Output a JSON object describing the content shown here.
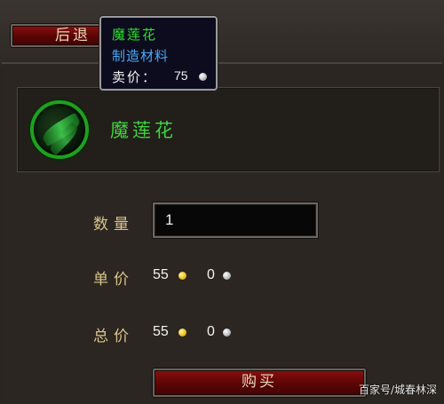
{
  "header": {
    "back_label": "后退"
  },
  "tooltip": {
    "item_name": "魔莲花",
    "item_type": "制造材料",
    "sell_label": "卖价：",
    "sell_price": "75",
    "sell_coin": "silver-coin-icon"
  },
  "item": {
    "name": "魔莲花",
    "icon": "lotus-herb-icon",
    "name_color": "#3fd23f",
    "border_color": "#1fa01f"
  },
  "form": {
    "quantity_label": "数量",
    "quantity_value": "1",
    "unit_price_label": "单价",
    "unit_gold": "55",
    "unit_silver": "0",
    "total_price_label": "总价",
    "total_gold": "55",
    "total_silver": "0"
  },
  "actions": {
    "buy_label": "购买"
  },
  "watermark": "百家号/城春林深",
  "colors": {
    "button_red": "#6a0808",
    "label_gold": "#d9c48a",
    "tooltip_bg": "#0c0c1e",
    "gold_coin": "#e8c020",
    "silver_coin": "#b8b8b8"
  }
}
